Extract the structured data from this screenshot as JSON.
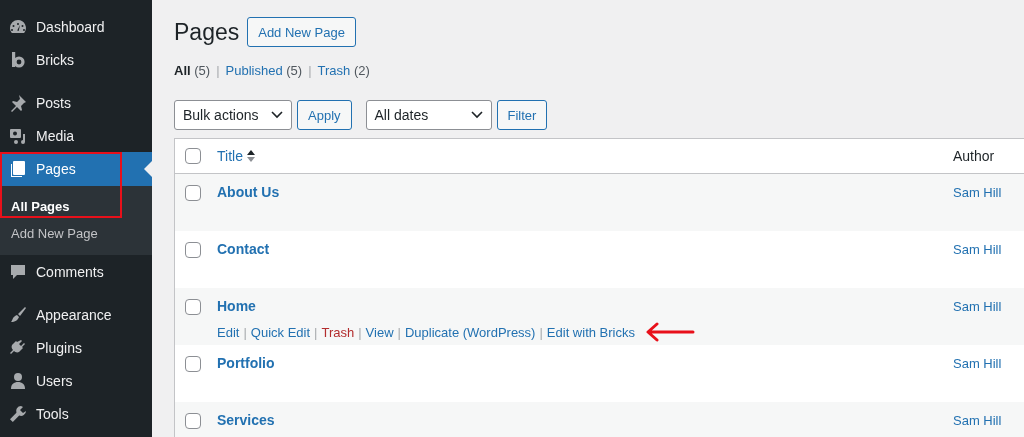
{
  "sidebar": {
    "groups": [
      [
        {
          "label": "Dashboard",
          "selected": false,
          "marked": false
        },
        {
          "label": "Bricks",
          "selected": false,
          "marked": false
        }
      ],
      [
        {
          "label": "Posts",
          "selected": false,
          "marked": false
        },
        {
          "label": "Media",
          "selected": false,
          "marked": false
        },
        {
          "label": "Pages",
          "selected": true,
          "marked": true,
          "children": [
            {
              "label": "All Pages",
              "selected": true
            },
            {
              "label": "Add New Page",
              "selected": false
            }
          ]
        },
        {
          "label": "Comments",
          "selected": false,
          "marked": false
        }
      ],
      [
        {
          "label": "Appearance",
          "selected": false,
          "marked": false
        },
        {
          "label": "Plugins",
          "selected": false,
          "marked": false
        },
        {
          "label": "Users",
          "selected": false,
          "marked": false
        },
        {
          "label": "Tools",
          "selected": false,
          "marked": false
        }
      ]
    ]
  },
  "header": {
    "title": "Pages",
    "button": "Add New Page"
  },
  "views": [
    {
      "label": "All",
      "count": "(5)",
      "selected": true
    },
    {
      "separator": "|",
      "label": "Published",
      "count": "(5)",
      "selected": false
    },
    {
      "separator": "|",
      "label": "Trash",
      "count": "(2)",
      "selected": false
    }
  ],
  "filters": {
    "bulk_select": "Bulk actions",
    "apply": "Apply",
    "date_select": "All dates",
    "filter": "Filter"
  },
  "table": {
    "select_all_checked": false,
    "columns": [
      {
        "label": "Title",
        "sorted": true
      },
      {
        "label": "Author",
        "sorted": false
      }
    ],
    "rows": [
      {
        "title": "About Us",
        "author": "Sam Hill",
        "checked": false,
        "actions": []
      },
      {
        "title": "Contact",
        "author": "Sam Hill",
        "checked": false,
        "actions": []
      },
      {
        "title": "Home",
        "author": "Sam Hill",
        "checked": false,
        "actions": [
          {
            "label": "Edit",
            "kind": "link",
            "pointed": false
          },
          {
            "separator": "|",
            "label": "Quick Edit",
            "kind": "link",
            "pointed": false
          },
          {
            "separator": "|",
            "label": "Trash",
            "kind": "delete",
            "pointed": false
          },
          {
            "separator": "|",
            "label": "View",
            "kind": "link",
            "pointed": false
          },
          {
            "separator": "|",
            "label": "Duplicate (WordPress)",
            "kind": "link",
            "pointed": false
          },
          {
            "separator": "|",
            "label": "Edit with Bricks",
            "kind": "link",
            "pointed": true
          }
        ]
      },
      {
        "title": "Portfolio",
        "author": "Sam Hill",
        "checked": false,
        "actions": []
      },
      {
        "title": "Services",
        "author": "Sam Hill",
        "checked": false,
        "actions": []
      }
    ]
  }
}
